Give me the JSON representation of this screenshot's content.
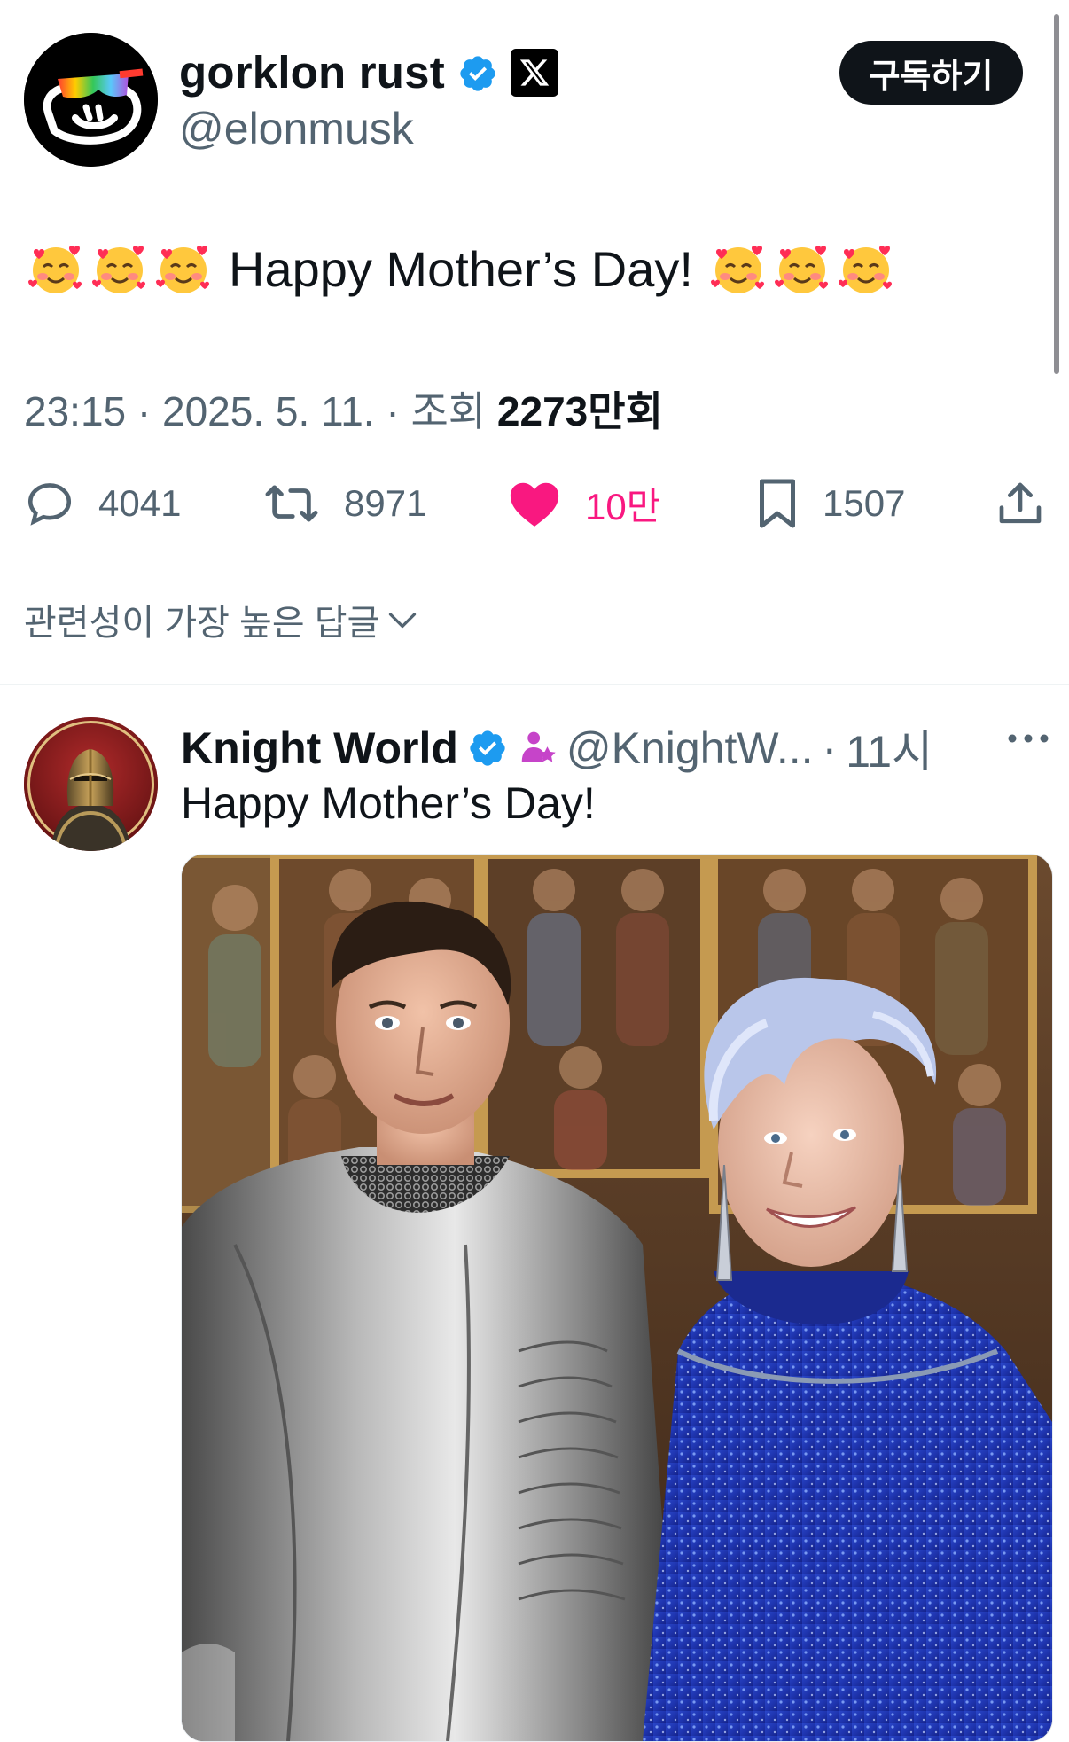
{
  "post": {
    "author": {
      "display_name": "gorklon rust",
      "handle": "@elonmusk",
      "verified_icon": "verified-badge-icon",
      "affiliation_icon": "x-logo-icon"
    },
    "subscribe_label": "구독하기",
    "text": "Happy Mother’s Day!",
    "emoji_name": "smiling-face-with-hearts",
    "meta": {
      "time": "23:15",
      "date": "2025. 5. 11.",
      "views_label": "조회",
      "views_value": "2273",
      "views_suffix": "만회",
      "separator": "·"
    },
    "actions": {
      "replies": "4041",
      "reposts": "8971",
      "likes": "10만",
      "bookmarks": "1507"
    },
    "colors": {
      "like": "#f91880",
      "verified": "#1d9bf0",
      "muted": "#536471"
    }
  },
  "replies_sort": {
    "label": "관련성이 가장 높은 답글"
  },
  "reply": {
    "display_name": "Knight World",
    "handle": "@KnightW...",
    "separator": "·",
    "time": "11시",
    "text": "Happy Mother’s Day!",
    "image_alt_icon": "knight-and-mother-photo"
  }
}
